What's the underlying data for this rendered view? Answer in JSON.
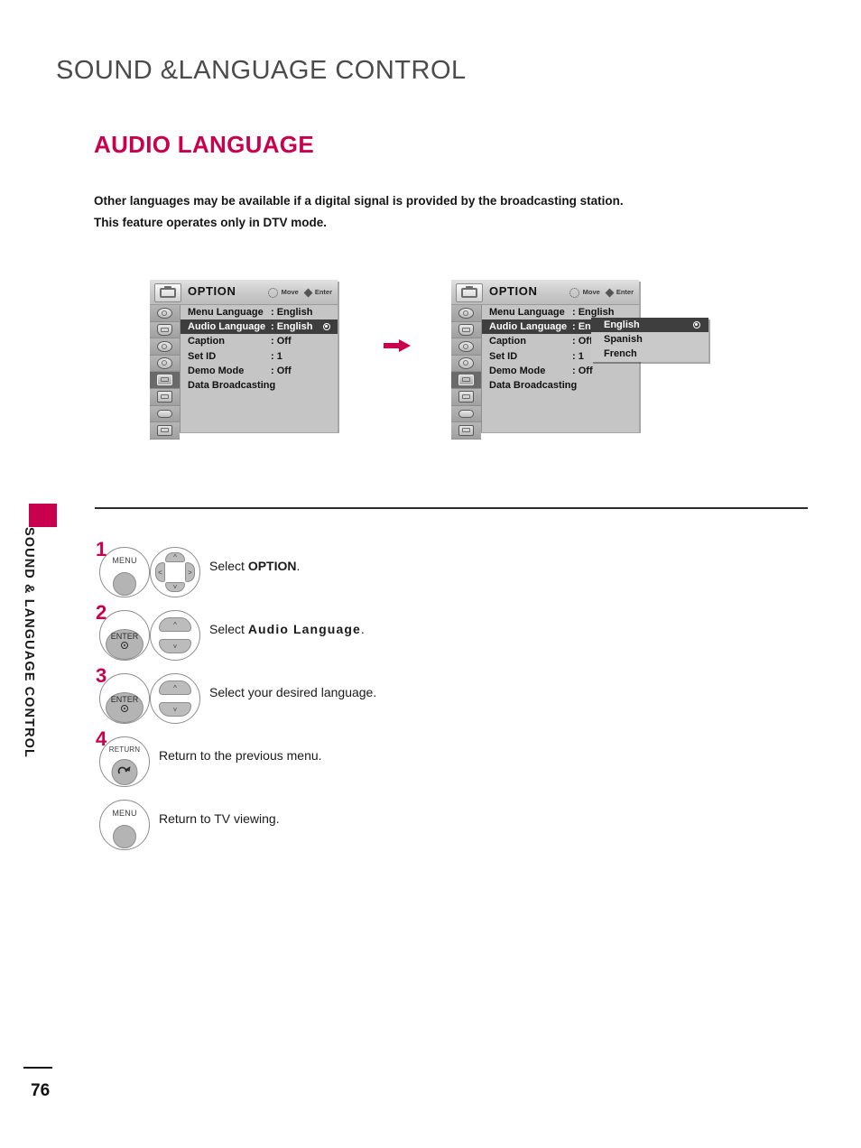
{
  "page": {
    "chapter_title": "SOUND &LANGUAGE CONTROL",
    "section_title": "AUDIO LANGUAGE",
    "intro_line1": "Other languages may be available if a digital signal is provided by the broadcasting station.",
    "intro_line2": "This feature operates only in DTV mode.",
    "side_tab_label": "SOUND & LANGUAGE CONTROL",
    "page_number": "76",
    "accent_color": "#c9004e",
    "title_color": "#4b4b4b"
  },
  "osd": {
    "title": "OPTION",
    "hint_move": "Move",
    "hint_enter": "Enter",
    "rows": [
      {
        "label": "Menu Language",
        "value": ": English",
        "selected": false,
        "marker": false
      },
      {
        "label": "Audio Language",
        "value": ": English",
        "selected": true,
        "marker": true
      },
      {
        "label": "Caption",
        "value": ": Off",
        "selected": false,
        "marker": false
      },
      {
        "label": "Set ID",
        "value": ": 1",
        "selected": false,
        "marker": false
      },
      {
        "label": "Demo Mode",
        "value": ": Off",
        "selected": false,
        "marker": false
      },
      {
        "label": "Data Broadcasting",
        "value": "",
        "selected": false,
        "marker": false
      }
    ],
    "rows_right": [
      {
        "label": "Menu Language",
        "value": ": English",
        "selected": false,
        "marker": false
      },
      {
        "label": "Audio Language",
        "value": ": Eng",
        "selected": true,
        "marker": false
      },
      {
        "label": "Caption",
        "value": ": Off",
        "selected": false,
        "marker": false
      },
      {
        "label": "Set ID",
        "value": ": 1",
        "selected": false,
        "marker": false
      },
      {
        "label": "Demo Mode",
        "value": ": Off",
        "selected": false,
        "marker": false
      },
      {
        "label": "Data Broadcasting",
        "value": "",
        "selected": false,
        "marker": false
      }
    ],
    "popup_options": [
      {
        "label": "English",
        "selected": true,
        "marker": true
      },
      {
        "label": "Spanish",
        "selected": false,
        "marker": false
      },
      {
        "label": "French",
        "selected": false,
        "marker": false
      }
    ]
  },
  "steps": [
    {
      "number": "1",
      "button_label": "MENU",
      "text_prefix": "Select ",
      "text_bold": "OPTION",
      "text_suffix": "."
    },
    {
      "number": "2",
      "button_label": "ENTER",
      "text_prefix": "Select ",
      "text_bold": "Audio Language",
      "text_suffix": "."
    },
    {
      "number": "3",
      "button_label": "ENTER",
      "text_prefix": "Select your desired language.",
      "text_bold": "",
      "text_suffix": ""
    },
    {
      "number": "4",
      "button_label": "RETURN",
      "text_prefix": "Return to the previous menu.",
      "text_bold": "",
      "text_suffix": ""
    },
    {
      "number": "",
      "button_label": "MENU",
      "text_prefix": "Return to TV viewing.",
      "text_bold": "",
      "text_suffix": ""
    }
  ]
}
